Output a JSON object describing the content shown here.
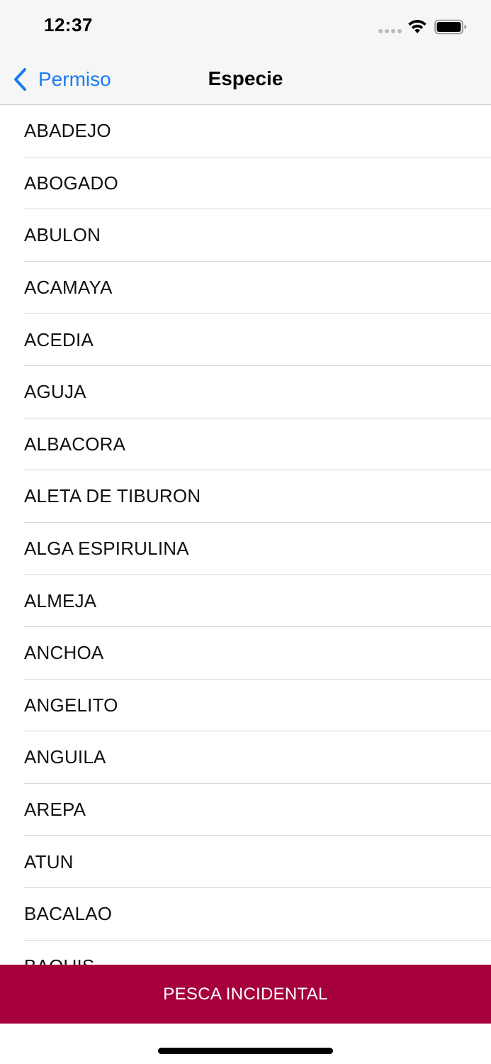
{
  "status_bar": {
    "time": "12:37",
    "icons": [
      "signal-dots-icon",
      "wifi-icon",
      "battery-icon"
    ]
  },
  "nav": {
    "back_label": "Permiso",
    "back_icon": "chevron-left-icon",
    "title": "Especie"
  },
  "colors": {
    "accent": "#1a7cf4",
    "button_bg": "#a5003c",
    "bar_bg": "#f6f6f6"
  },
  "species": [
    "ABADEJO",
    "ABOGADO",
    "ABULON",
    "ACAMAYA",
    "ACEDIA",
    "AGUJA",
    "ALBACORA",
    "ALETA DE TIBURON",
    "ALGA ESPIRULINA",
    "ALMEJA",
    "ANCHOA",
    "ANGELITO",
    "ANGUILA",
    "AREPA",
    "ATUN",
    "BACALAO",
    "BAQUIS"
  ],
  "footer_button": {
    "label": "PESCA INCIDENTAL"
  }
}
